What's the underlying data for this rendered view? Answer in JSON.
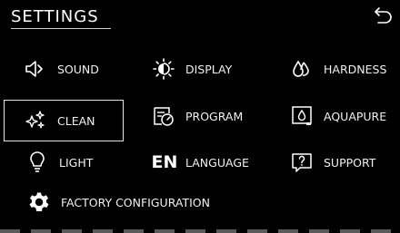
{
  "header": {
    "title": "SETTINGS"
  },
  "menu": {
    "sound": "SOUND",
    "display": "DISPLAY",
    "hardness": "HARDNESS",
    "clean": "CLEAN",
    "program": "PROGRAM",
    "aquapure": "AQUAPURE",
    "light": "LIGHT",
    "language_code": "EN",
    "language": "LANGUAGE",
    "support": "SUPPORT",
    "factory": "FACTORY CONFIGURATION"
  },
  "selected_item": "CLEAN",
  "icons": {
    "back": "back-arrow-icon",
    "sound": "speaker-icon",
    "display": "sun-brightness-icon",
    "hardness": "water-drops-icon",
    "clean": "sparkle-icon",
    "program": "program-timer-icon",
    "aquapure": "filter-drop-icon",
    "light": "bulb-icon",
    "support": "question-icon",
    "factory": "gear-icon"
  },
  "colors": {
    "background": "#000000",
    "text": "#ffffff",
    "selection_border": "#e6e6e6"
  }
}
